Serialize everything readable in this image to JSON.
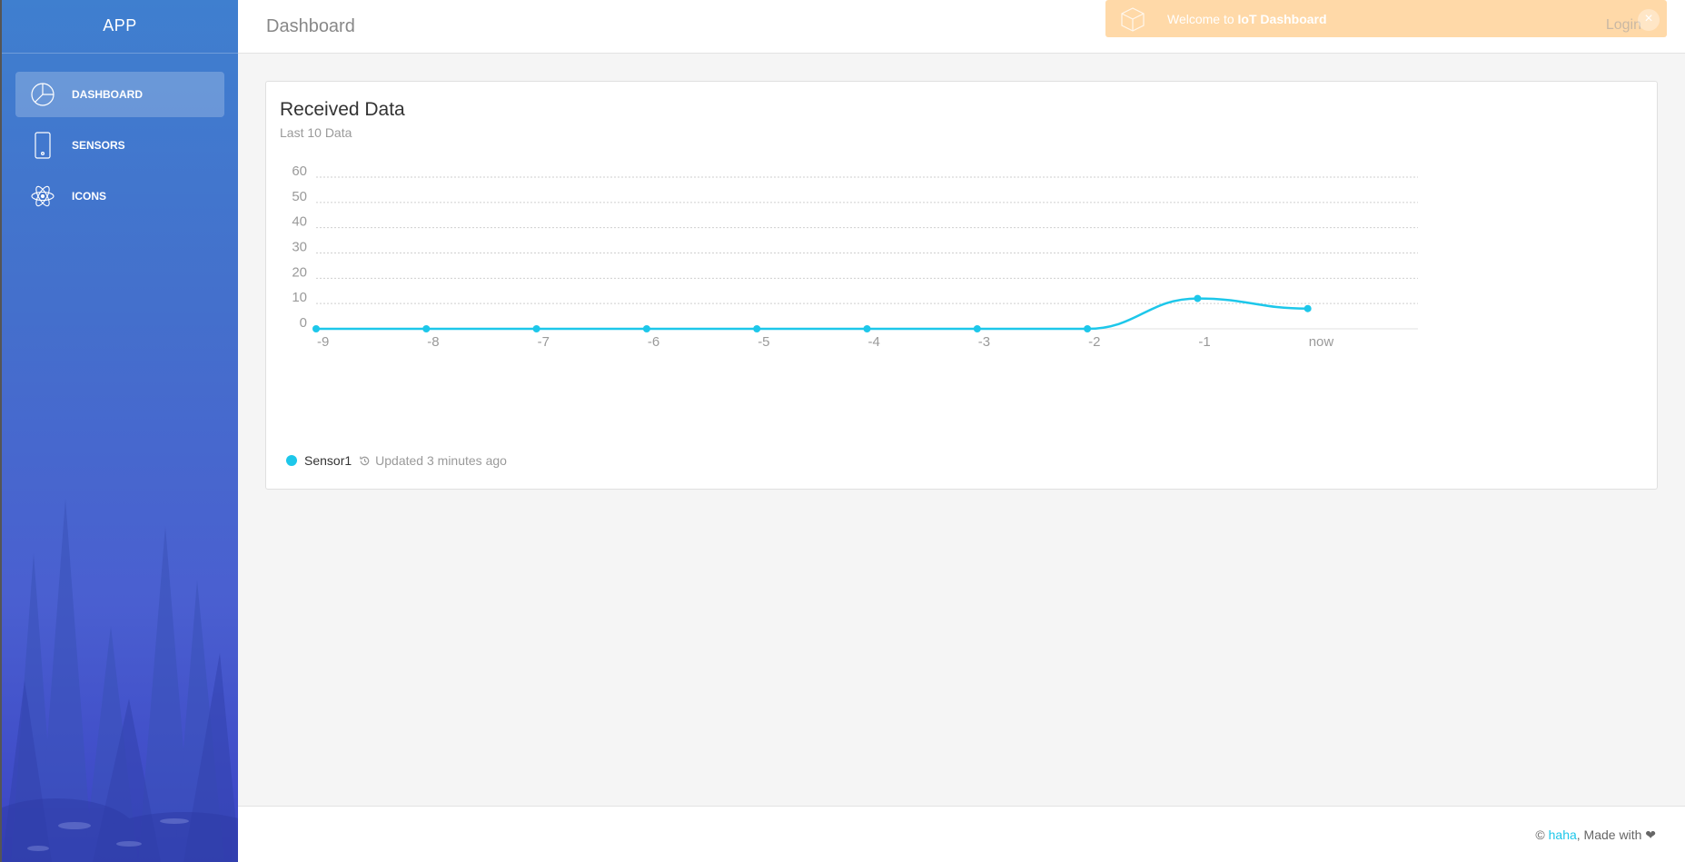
{
  "sidebar": {
    "logo": "APP",
    "items": [
      {
        "label": "DASHBOARD",
        "icon": "pie-chart-icon",
        "active": true
      },
      {
        "label": "SENSORS",
        "icon": "phone-icon",
        "active": false
      },
      {
        "label": "ICONS",
        "icon": "atom-icon",
        "active": false
      }
    ]
  },
  "header": {
    "title": "Dashboard"
  },
  "notification": {
    "prefix": "Welcome to ",
    "strong": "IoT Dashboard",
    "login": "Login",
    "close": "×",
    "icon": "box-icon",
    "color": "#ffd9a8"
  },
  "card": {
    "title": "Received Data",
    "subtitle": "Last 10 Data",
    "legend_name": "Sensor1",
    "update_text": "Updated 3 minutes ago",
    "update_icon": "history-icon"
  },
  "chart_data": {
    "type": "line",
    "x": [
      "-9",
      "-8",
      "-7",
      "-6",
      "-5",
      "-4",
      "-3",
      "-2",
      "-1",
      "now"
    ],
    "series": [
      {
        "name": "Sensor1",
        "values": [
          0,
          0,
          0,
          0,
          0,
          0,
          0,
          0,
          12,
          8
        ],
        "color": "#1dc7ea"
      }
    ],
    "yticks": [
      0,
      10,
      20,
      30,
      40,
      50,
      60
    ],
    "ylim": [
      0,
      60
    ],
    "grid": true,
    "smooth": true
  },
  "footer": {
    "copyright": "© ",
    "link": "haha",
    "suffix": ", Made with ❤"
  },
  "colors": {
    "accent": "#1dc7ea",
    "sidebar_top": "#3f7fcf",
    "sidebar_bottom": "#3b44c4"
  }
}
